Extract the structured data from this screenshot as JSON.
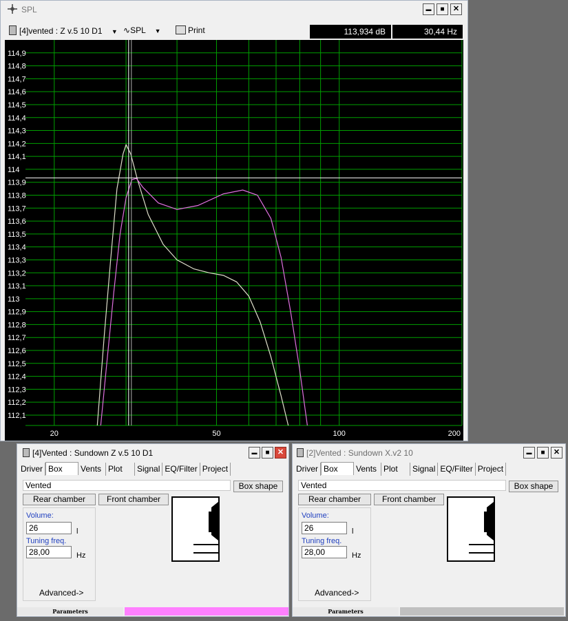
{
  "spl_window": {
    "title": "SPL",
    "icon": "crosshair-icon",
    "toolbar": {
      "project_select": "[4]vented : Z v.5 10 D1",
      "curve_select": "SPL",
      "print_label": "Print",
      "readout_db": "113,934 dB",
      "readout_hz": "30,44 Hz"
    },
    "controls": {
      "minimize": "▬",
      "maximize": "■",
      "close": "✕"
    }
  },
  "chart_data": {
    "type": "line",
    "xscale": "log",
    "xlim": [
      17,
      200
    ],
    "ylim": [
      112.02,
      115.0
    ],
    "x_ticks": [
      "20",
      "50",
      "100",
      "200"
    ],
    "y_ticks": [
      "114,9",
      "114,8",
      "114,7",
      "114,6",
      "114,5",
      "114,4",
      "114,3",
      "114,2",
      "114,1",
      "114",
      "113,9",
      "113,8",
      "113,7",
      "113,6",
      "113,5",
      "113,4",
      "113,3",
      "113,2",
      "113,1",
      "113",
      "112,9",
      "112,8",
      "112,7",
      "112,6",
      "112,5",
      "112,4",
      "112,3",
      "112,2",
      "112,1"
    ],
    "cursor": {
      "x": 30.44,
      "y": 113.934
    },
    "colors": {
      "background": "#000000",
      "grid": "#00a000",
      "series_1": "#e0e0cc",
      "series_2": "#e070e0",
      "cursor": "#ffffff"
    },
    "series": [
      {
        "color": "#e0e0cc",
        "points": [
          [
            25.5,
            112.02
          ],
          [
            26.5,
            112.7
          ],
          [
            27.5,
            113.3
          ],
          [
            28.5,
            113.85
          ],
          [
            29.5,
            114.12
          ],
          [
            30.0,
            114.19
          ],
          [
            30.8,
            114.12
          ],
          [
            32.0,
            113.92
          ],
          [
            34.0,
            113.65
          ],
          [
            37.0,
            113.42
          ],
          [
            40.0,
            113.3
          ],
          [
            44.0,
            113.23
          ],
          [
            48.0,
            113.2
          ],
          [
            52.0,
            113.18
          ],
          [
            56.0,
            113.13
          ],
          [
            60.0,
            113.02
          ],
          [
            64.0,
            112.82
          ],
          [
            68.0,
            112.55
          ],
          [
            72.0,
            112.25
          ],
          [
            75.0,
            112.02
          ]
        ]
      },
      {
        "color": "#e070e0",
        "points": [
          [
            26.0,
            112.02
          ],
          [
            27.0,
            112.55
          ],
          [
            28.0,
            113.05
          ],
          [
            29.0,
            113.5
          ],
          [
            30.0,
            113.78
          ],
          [
            31.0,
            113.92
          ],
          [
            31.8,
            113.93
          ],
          [
            33.0,
            113.86
          ],
          [
            36.0,
            113.74
          ],
          [
            40.0,
            113.69
          ],
          [
            45.0,
            113.72
          ],
          [
            52.0,
            113.81
          ],
          [
            58.0,
            113.84
          ],
          [
            63.0,
            113.8
          ],
          [
            68.0,
            113.62
          ],
          [
            72.0,
            113.32
          ],
          [
            76.0,
            112.9
          ],
          [
            80.0,
            112.45
          ],
          [
            83.5,
            112.02
          ]
        ]
      }
    ]
  },
  "panel_left": {
    "title": "[4]Vented : Sundown Z v.5 10 D1",
    "title_color": "#000000",
    "tabs": [
      "Driver",
      "Box",
      "Vents",
      "Plot",
      "Signal",
      "EQ/Filter",
      "Project"
    ],
    "active_tab": "Box",
    "box_type": "Vented",
    "box_shape_button": "Box shape",
    "rear_chamber_button": "Rear chamber",
    "front_chamber_button": "Front chamber",
    "volume_label": "Volume:",
    "volume_value": "26",
    "volume_unit": "l",
    "tuning_label": "Tuning freq.",
    "tuning_value": "28,00",
    "tuning_unit": "Hz",
    "advanced_label": "Advanced->",
    "status_label": "Parameters",
    "status_color": "#ff80ff"
  },
  "panel_right": {
    "title": "[2]Vented : Sundown X.v2 10",
    "title_color": "#6d6d6d",
    "tabs": [
      "Driver",
      "Box",
      "Vents",
      "Plot",
      "Signal",
      "EQ/Filter",
      "Project"
    ],
    "active_tab": "Box",
    "box_type": "Vented",
    "box_shape_button": "Box shape",
    "rear_chamber_button": "Rear chamber",
    "front_chamber_button": "Front chamber",
    "volume_label": "Volume:",
    "volume_value": "26",
    "volume_unit": "l",
    "tuning_label": "Tuning freq.",
    "tuning_value": "28,00",
    "tuning_unit": "Hz",
    "advanced_label": "Advanced->",
    "status_label": "Parameters",
    "status_color": "#c0c0c0"
  }
}
